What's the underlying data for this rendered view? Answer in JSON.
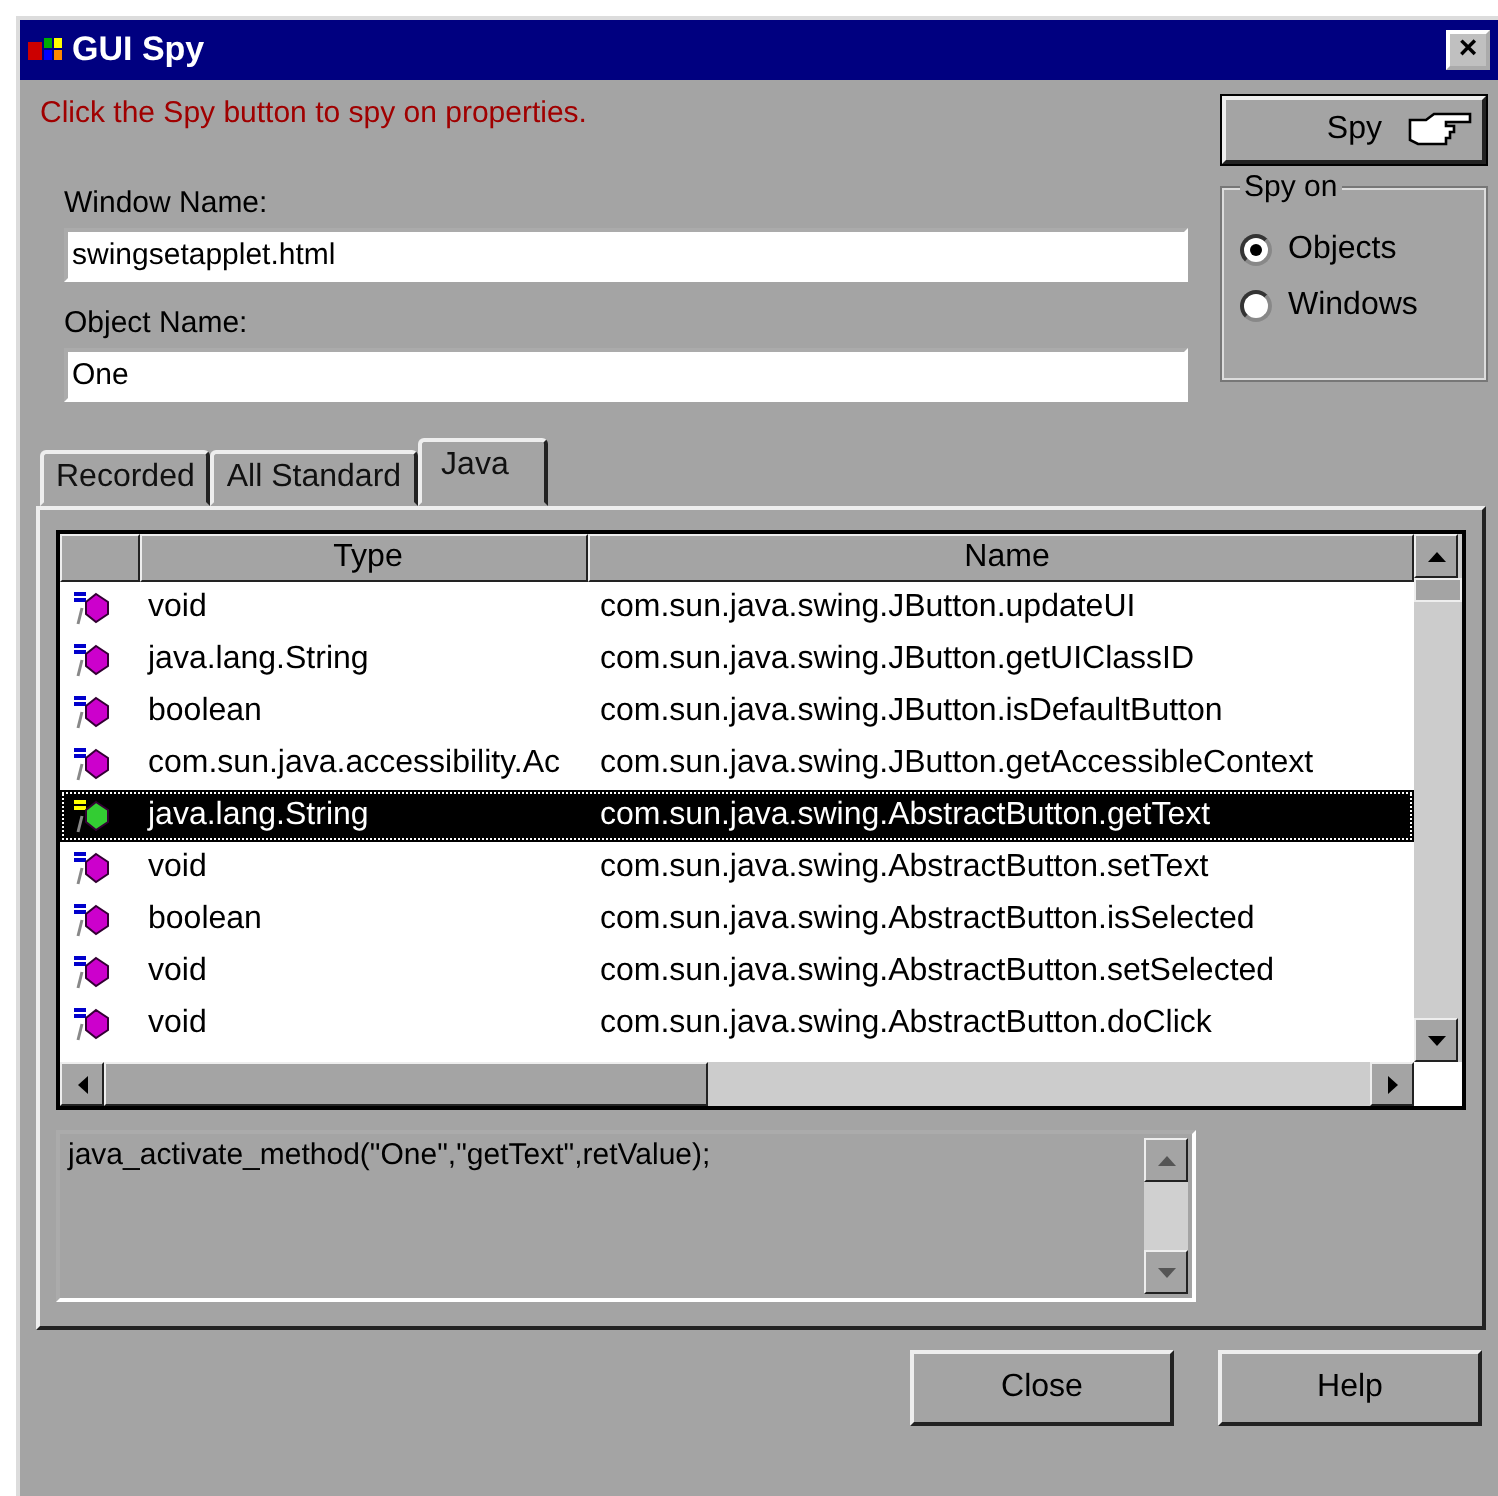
{
  "window": {
    "title": "GUI Spy",
    "close": "×"
  },
  "message": "Click the Spy button to spy on properties.",
  "spy_button": {
    "label": "Spy"
  },
  "window_name": {
    "label": "Window Name:",
    "value": "swingsetapplet.html"
  },
  "object_name": {
    "label": "Object Name:",
    "value": "One"
  },
  "spy_on": {
    "title": "Spy on",
    "options": [
      {
        "label": "Objects",
        "selected": true
      },
      {
        "label": "Windows",
        "selected": false
      }
    ]
  },
  "tabs": [
    {
      "label": "Recorded",
      "selected": false
    },
    {
      "label": "All Standard",
      "selected": false
    },
    {
      "label": "Java",
      "selected": true
    }
  ],
  "table": {
    "columns": [
      "Type",
      "Name"
    ],
    "rows": [
      {
        "type": "void",
        "name": "com.sun.java.swing.JButton.updateUI",
        "selected": false
      },
      {
        "type": "java.lang.String",
        "name": "com.sun.java.swing.JButton.getUIClassID",
        "selected": false
      },
      {
        "type": "boolean",
        "name": "com.sun.java.swing.JButton.isDefaultButton",
        "selected": false
      },
      {
        "type": "com.sun.java.accessibility.Ac",
        "name": "com.sun.java.swing.JButton.getAccessibleContext",
        "selected": false
      },
      {
        "type": "java.lang.String",
        "name": "com.sun.java.swing.AbstractButton.getText",
        "selected": true
      },
      {
        "type": "void",
        "name": "com.sun.java.swing.AbstractButton.setText",
        "selected": false
      },
      {
        "type": "boolean",
        "name": "com.sun.java.swing.AbstractButton.isSelected",
        "selected": false
      },
      {
        "type": "void",
        "name": "com.sun.java.swing.AbstractButton.setSelected",
        "selected": false
      },
      {
        "type": "void",
        "name": "com.sun.java.swing.AbstractButton.doClick",
        "selected": false
      }
    ]
  },
  "code": "java_activate_method(\"One\",\"getText\",retValue);",
  "buttons": [
    "Close",
    "Help"
  ]
}
